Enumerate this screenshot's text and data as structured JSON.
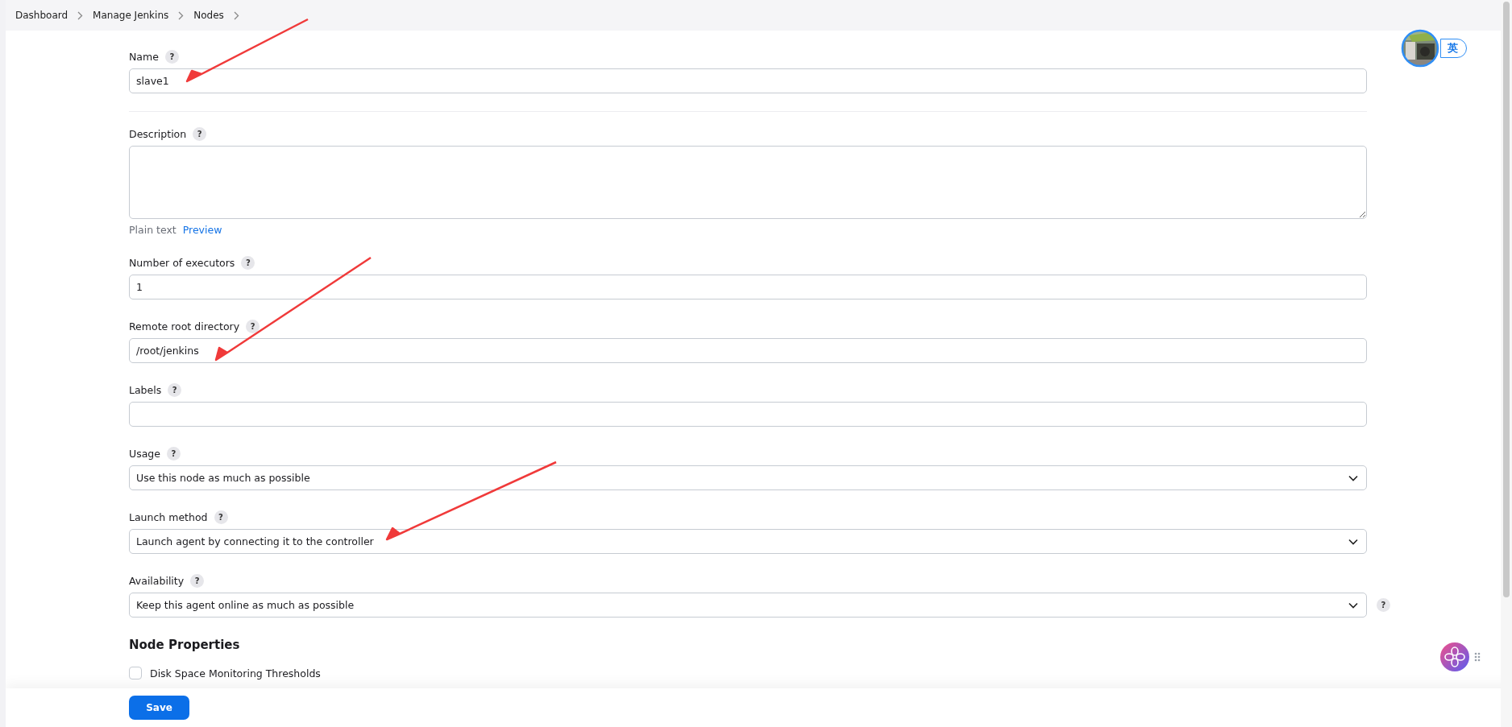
{
  "breadcrumb": [
    "Dashboard",
    "Manage Jenkins",
    "Nodes"
  ],
  "user_badge": {
    "label": "英"
  },
  "fields": [
    {
      "kind": "text",
      "label": "Name",
      "value": "slave1",
      "divider": true
    },
    {
      "kind": "textarea",
      "label": "Description",
      "format": "Plain text",
      "preview": "Preview"
    },
    {
      "kind": "text",
      "label": "Number of executors",
      "value": "1"
    },
    {
      "kind": "text",
      "label": "Remote root directory",
      "value": "/root/jenkins"
    },
    {
      "kind": "text",
      "label": "Labels"
    },
    {
      "kind": "select",
      "label": "Usage",
      "value": "Use this node as much as possible"
    },
    {
      "kind": "select",
      "label": "Launch method",
      "value": "Launch agent by connecting it to the controller"
    },
    {
      "kind": "select",
      "label": "Availability",
      "value": "Keep this agent online as much as possible",
      "side_help": "?"
    }
  ],
  "help_mark": "?",
  "section": {
    "title": "Node Properties",
    "options": [
      {
        "label": "Disk Space Monitoring Thresholds",
        "checked": false
      }
    ]
  },
  "save_button": "Save"
}
